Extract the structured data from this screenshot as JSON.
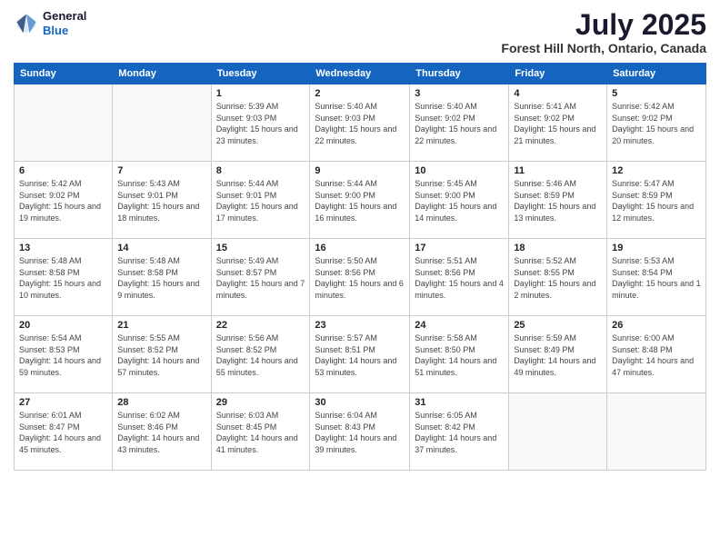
{
  "header": {
    "logo_line1": "General",
    "logo_line2": "Blue",
    "title": "July 2025",
    "subtitle": "Forest Hill North, Ontario, Canada"
  },
  "weekdays": [
    "Sunday",
    "Monday",
    "Tuesday",
    "Wednesday",
    "Thursday",
    "Friday",
    "Saturday"
  ],
  "weeks": [
    [
      {
        "day": "",
        "info": ""
      },
      {
        "day": "",
        "info": ""
      },
      {
        "day": "1",
        "info": "Sunrise: 5:39 AM\nSunset: 9:03 PM\nDaylight: 15 hours\nand 23 minutes."
      },
      {
        "day": "2",
        "info": "Sunrise: 5:40 AM\nSunset: 9:03 PM\nDaylight: 15 hours\nand 22 minutes."
      },
      {
        "day": "3",
        "info": "Sunrise: 5:40 AM\nSunset: 9:02 PM\nDaylight: 15 hours\nand 22 minutes."
      },
      {
        "day": "4",
        "info": "Sunrise: 5:41 AM\nSunset: 9:02 PM\nDaylight: 15 hours\nand 21 minutes."
      },
      {
        "day": "5",
        "info": "Sunrise: 5:42 AM\nSunset: 9:02 PM\nDaylight: 15 hours\nand 20 minutes."
      }
    ],
    [
      {
        "day": "6",
        "info": "Sunrise: 5:42 AM\nSunset: 9:02 PM\nDaylight: 15 hours\nand 19 minutes."
      },
      {
        "day": "7",
        "info": "Sunrise: 5:43 AM\nSunset: 9:01 PM\nDaylight: 15 hours\nand 18 minutes."
      },
      {
        "day": "8",
        "info": "Sunrise: 5:44 AM\nSunset: 9:01 PM\nDaylight: 15 hours\nand 17 minutes."
      },
      {
        "day": "9",
        "info": "Sunrise: 5:44 AM\nSunset: 9:00 PM\nDaylight: 15 hours\nand 16 minutes."
      },
      {
        "day": "10",
        "info": "Sunrise: 5:45 AM\nSunset: 9:00 PM\nDaylight: 15 hours\nand 14 minutes."
      },
      {
        "day": "11",
        "info": "Sunrise: 5:46 AM\nSunset: 8:59 PM\nDaylight: 15 hours\nand 13 minutes."
      },
      {
        "day": "12",
        "info": "Sunrise: 5:47 AM\nSunset: 8:59 PM\nDaylight: 15 hours\nand 12 minutes."
      }
    ],
    [
      {
        "day": "13",
        "info": "Sunrise: 5:48 AM\nSunset: 8:58 PM\nDaylight: 15 hours\nand 10 minutes."
      },
      {
        "day": "14",
        "info": "Sunrise: 5:48 AM\nSunset: 8:58 PM\nDaylight: 15 hours\nand 9 minutes."
      },
      {
        "day": "15",
        "info": "Sunrise: 5:49 AM\nSunset: 8:57 PM\nDaylight: 15 hours\nand 7 minutes."
      },
      {
        "day": "16",
        "info": "Sunrise: 5:50 AM\nSunset: 8:56 PM\nDaylight: 15 hours\nand 6 minutes."
      },
      {
        "day": "17",
        "info": "Sunrise: 5:51 AM\nSunset: 8:56 PM\nDaylight: 15 hours\nand 4 minutes."
      },
      {
        "day": "18",
        "info": "Sunrise: 5:52 AM\nSunset: 8:55 PM\nDaylight: 15 hours\nand 2 minutes."
      },
      {
        "day": "19",
        "info": "Sunrise: 5:53 AM\nSunset: 8:54 PM\nDaylight: 15 hours\nand 1 minute."
      }
    ],
    [
      {
        "day": "20",
        "info": "Sunrise: 5:54 AM\nSunset: 8:53 PM\nDaylight: 14 hours\nand 59 minutes."
      },
      {
        "day": "21",
        "info": "Sunrise: 5:55 AM\nSunset: 8:52 PM\nDaylight: 14 hours\nand 57 minutes."
      },
      {
        "day": "22",
        "info": "Sunrise: 5:56 AM\nSunset: 8:52 PM\nDaylight: 14 hours\nand 55 minutes."
      },
      {
        "day": "23",
        "info": "Sunrise: 5:57 AM\nSunset: 8:51 PM\nDaylight: 14 hours\nand 53 minutes."
      },
      {
        "day": "24",
        "info": "Sunrise: 5:58 AM\nSunset: 8:50 PM\nDaylight: 14 hours\nand 51 minutes."
      },
      {
        "day": "25",
        "info": "Sunrise: 5:59 AM\nSunset: 8:49 PM\nDaylight: 14 hours\nand 49 minutes."
      },
      {
        "day": "26",
        "info": "Sunrise: 6:00 AM\nSunset: 8:48 PM\nDaylight: 14 hours\nand 47 minutes."
      }
    ],
    [
      {
        "day": "27",
        "info": "Sunrise: 6:01 AM\nSunset: 8:47 PM\nDaylight: 14 hours\nand 45 minutes."
      },
      {
        "day": "28",
        "info": "Sunrise: 6:02 AM\nSunset: 8:46 PM\nDaylight: 14 hours\nand 43 minutes."
      },
      {
        "day": "29",
        "info": "Sunrise: 6:03 AM\nSunset: 8:45 PM\nDaylight: 14 hours\nand 41 minutes."
      },
      {
        "day": "30",
        "info": "Sunrise: 6:04 AM\nSunset: 8:43 PM\nDaylight: 14 hours\nand 39 minutes."
      },
      {
        "day": "31",
        "info": "Sunrise: 6:05 AM\nSunset: 8:42 PM\nDaylight: 14 hours\nand 37 minutes."
      },
      {
        "day": "",
        "info": ""
      },
      {
        "day": "",
        "info": ""
      }
    ]
  ]
}
